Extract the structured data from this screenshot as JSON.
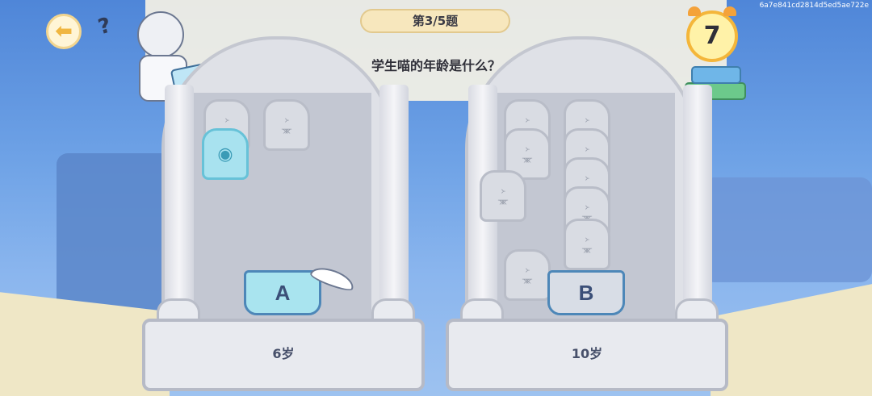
{
  "hash_text": "6a7e841cd2814d5ed5ae722e",
  "header": {
    "question_counter": "第3/5题",
    "question": "学生喵的年龄是什么？"
  },
  "timer": {
    "seconds": "7"
  },
  "choices": [
    {
      "letter": "A",
      "answer": "6岁"
    },
    {
      "letter": "B",
      "answer": "10岁"
    }
  ],
  "icons": {
    "back": "back-arrow-icon",
    "timer": "alarm-clock-icon",
    "books": "book-stack-icon"
  },
  "colors": {
    "accent_gold": "#f4b63a",
    "book_a": "#a9e4ef",
    "book_b": "#d8dde6"
  }
}
